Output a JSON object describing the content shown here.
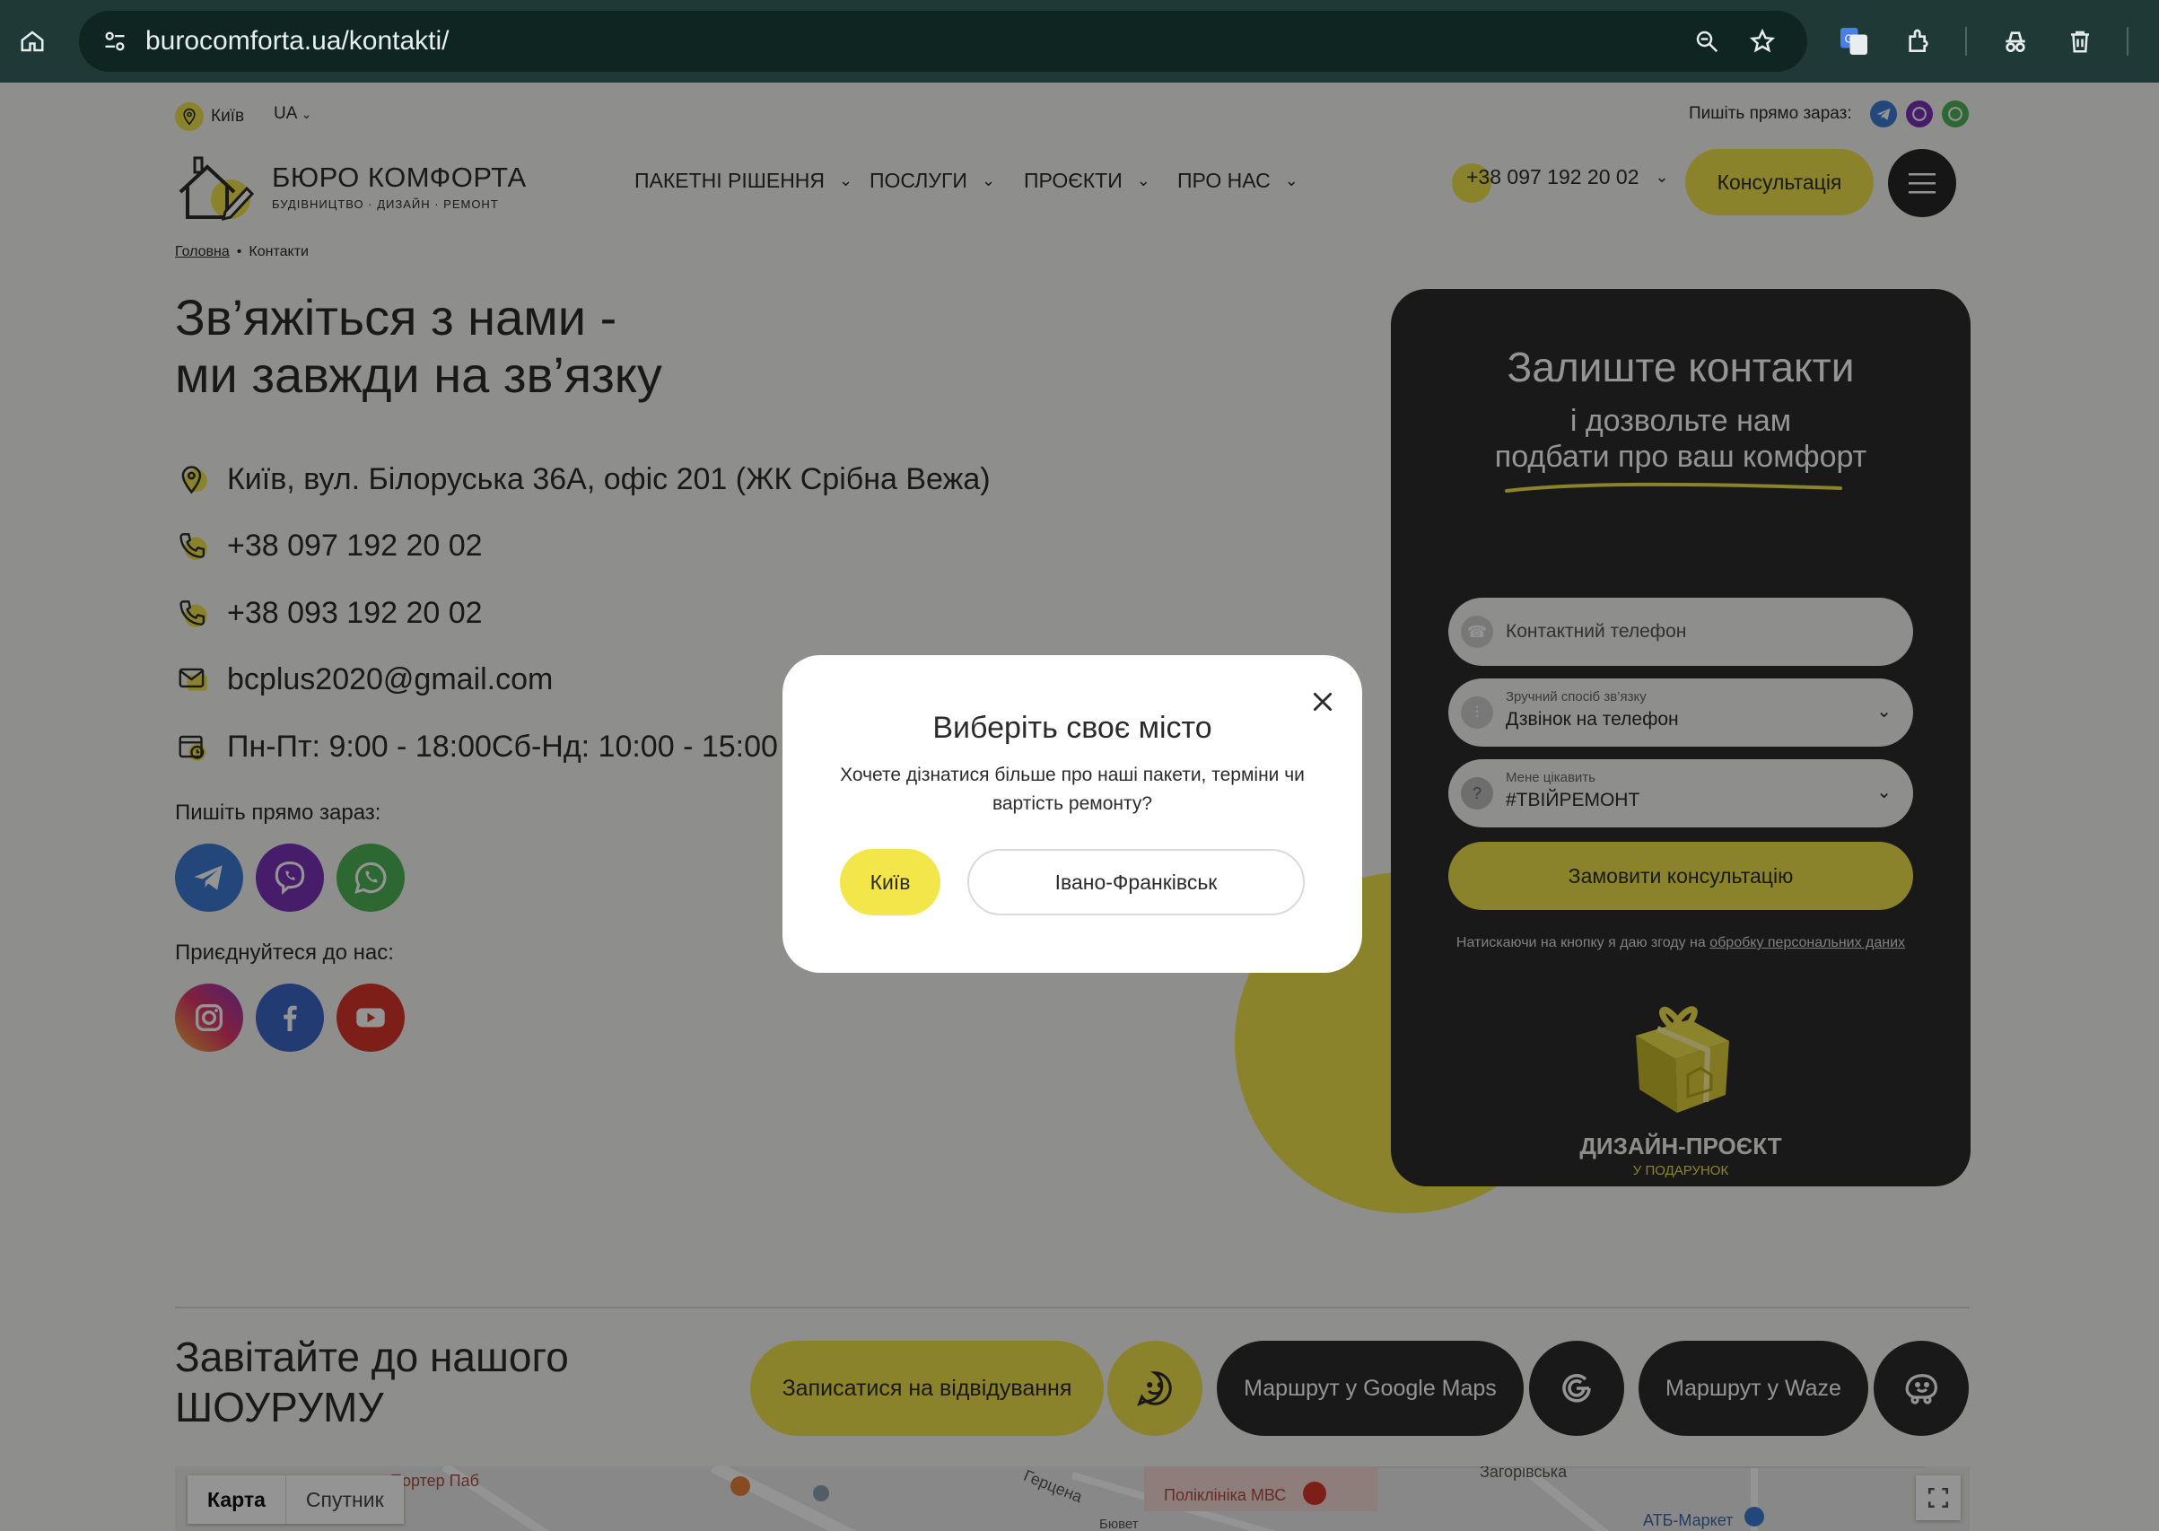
{
  "browser": {
    "url": "burocomforta.ua/kontakti/"
  },
  "topbar": {
    "city": "Київ",
    "lang": "UA",
    "write_now": "Пишіть прямо зараз:"
  },
  "logo": {
    "title": "БЮРО КОМФОРТА",
    "subtitle": "БУДІВНИЦТВО · ДИЗАЙН · РЕМОНТ"
  },
  "nav": {
    "items": [
      {
        "label": "ПАКЕТНІ РІШЕННЯ"
      },
      {
        "label": "ПОСЛУГИ"
      },
      {
        "label": "ПРОЄКТИ"
      },
      {
        "label": "ПРО НАС"
      }
    ],
    "phone": "+38 097 192 20 02",
    "consult": "Консультація"
  },
  "breadcrumb": {
    "home": "Головна",
    "sep": "•",
    "current": "Контакти"
  },
  "hero": {
    "title_line1": "Зв’яжіться з нами -",
    "title_line2": "ми завжди на зв’язку"
  },
  "contacts": {
    "address": "Київ, вул. Білоруська 36А, офіс 201 (ЖК Срібна Вежа)",
    "phone1": "+38 097 192 20 02",
    "phone2": "+38 093 192 20 02",
    "email": "bcplus2020@gmail.com",
    "hours": "Пн-Пт: 9:00 - 18:00Сб-Нд: 10:00 - 15:00",
    "write_now": "Пишіть прямо зараз:",
    "join_us": "Приєднуйтеся до нас:"
  },
  "form": {
    "title": "Залиште контакти",
    "sub1": "і дозвольте нам",
    "sub2": "подбати про ваш комфорт",
    "phone_placeholder": "Контактний телефон",
    "method_label": "Зручний спосіб зв’язку",
    "method_value": "Дзвінок на телефон",
    "interest_label": "Мене цікавить",
    "interest_value": "#ТВІЙРЕМОНТ",
    "submit": "Замовити консультацію",
    "consent_text": "Натискаючи на кнопку я даю згоду на ",
    "consent_link": "обробку персональних даних",
    "gift_title": "ДИЗАЙН-ПРОЄКТ",
    "gift_sub": "У ПОДАРУНОК"
  },
  "showroom": {
    "title_line1": "Завітайте до нашого",
    "title_line2": "ШОУРУМУ",
    "visit": "Записатися на відвідування",
    "google": "Маршрут у Google Maps",
    "waze": "Маршрут у Waze"
  },
  "map": {
    "tab_map": "Карта",
    "tab_sat": "Спутник",
    "labels": [
      "Портер Паб",
      "Герцена",
      "Поліклініка МВС",
      "Загорівська",
      "АТБ-Маркет",
      "Бювет"
    ]
  },
  "modal": {
    "title": "Виберіть своє місто",
    "text": "Хочете дізнатися більше про наші пакети, терміни чи вартість ремонту?",
    "kyiv": "Київ",
    "ivano": "Івано-Франківськ"
  },
  "colors": {
    "accent": "#f0e24a",
    "dark": "#2b2b2b",
    "chrome": "#1f3a36"
  }
}
